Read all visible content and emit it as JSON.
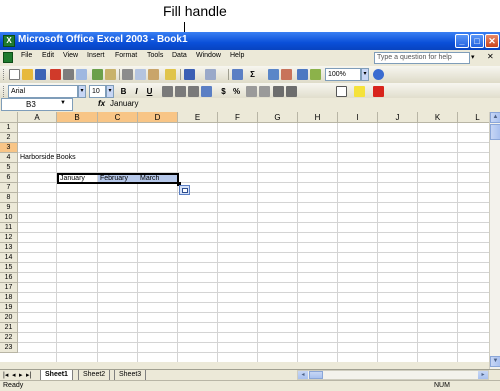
{
  "annotation": {
    "label": "Fill handle"
  },
  "window": {
    "title": "Microsoft Office Excel 2003 - Book1",
    "buttons": {
      "minimize": "_",
      "maximize": "□",
      "close": "✕"
    }
  },
  "menu": {
    "items": [
      "File",
      "Edit",
      "View",
      "Insert",
      "Format",
      "Tools",
      "Data",
      "Window",
      "Help"
    ],
    "ask_placeholder": "Type a question for help"
  },
  "standard_toolbar": {
    "zoom": "100%"
  },
  "formatting_toolbar": {
    "font": "Arial",
    "size": "10",
    "bold": "B",
    "italic": "I",
    "underline": "U",
    "currency": "$",
    "percent": "%"
  },
  "formula_bar": {
    "name_box": "B3",
    "fx": "fx",
    "content": "January"
  },
  "grid": {
    "columns": [
      "A",
      "B",
      "C",
      "D",
      "E",
      "F",
      "G",
      "H",
      "I",
      "J",
      "K",
      "L"
    ],
    "selected_columns": [
      "B",
      "C",
      "D"
    ],
    "rows": [
      "1",
      "2",
      "3",
      "4",
      "5",
      "6",
      "7",
      "8",
      "9",
      "10",
      "11",
      "12",
      "13",
      "14",
      "15",
      "16",
      "17",
      "18",
      "19",
      "20",
      "21",
      "22",
      "23"
    ],
    "selected_row": "3",
    "cells": {
      "A1": "Harborside Books",
      "B3": "January",
      "C3": "February",
      "D3": "March"
    }
  },
  "sheets": [
    "Sheet1",
    "Sheet2",
    "Sheet3"
  ],
  "active_sheet": "Sheet1",
  "status": {
    "mode": "Ready",
    "num": "NUM"
  },
  "colors": {
    "title_blue": "#0a4fd8",
    "selection_header": "#f8c586",
    "selection_fill": "#b6c8ea"
  }
}
